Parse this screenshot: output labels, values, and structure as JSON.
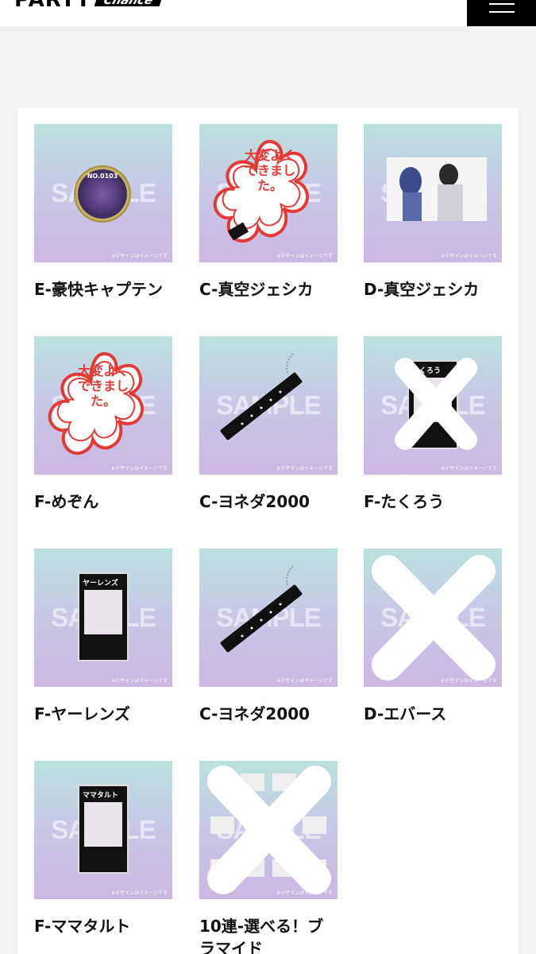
{
  "header": {
    "logo_main": "PARTY",
    "logo_badge": "Chance"
  },
  "thumbnail": {
    "watermark": "SAMPLE",
    "note": "※デザインはイメージです",
    "copyright": "©BY YOSHIMOTO"
  },
  "items": [
    {
      "title": "E-豪快キャプテン",
      "art": "badge",
      "badge_number": "NO.0103"
    },
    {
      "title": "C-真空ジェシカ",
      "art": "stamp-keychain",
      "stamp_text": "大変よくできました。"
    },
    {
      "title": "D-真空ジェシカ",
      "art": "photo"
    },
    {
      "title": "F-めぞん",
      "art": "stamp",
      "stamp_text": "大変よくできました。"
    },
    {
      "title": "C-ヨネダ2000",
      "art": "stick-keychain"
    },
    {
      "title": "F-たくろう",
      "art": "card-crossed",
      "card_header": "たくろう"
    },
    {
      "title": "F-ヤーレンズ",
      "art": "card",
      "card_header": "ヤーレンズ"
    },
    {
      "title": "C-ヨネダ2000",
      "art": "stick-keychain"
    },
    {
      "title": "D-エバース",
      "art": "crossed"
    },
    {
      "title": "F-ママタルト",
      "art": "card",
      "card_header": "ママタルト"
    },
    {
      "title": "10連-選べる！ブ ラマイド",
      "art": "collage-crossed"
    }
  ],
  "colors": {
    "page_bg": "#f2f2f2",
    "thumb_top": "#b9e2dd",
    "thumb_bottom": "#cbb7e3",
    "stamp_red": "#e53935",
    "menu_bg": "#000000"
  }
}
